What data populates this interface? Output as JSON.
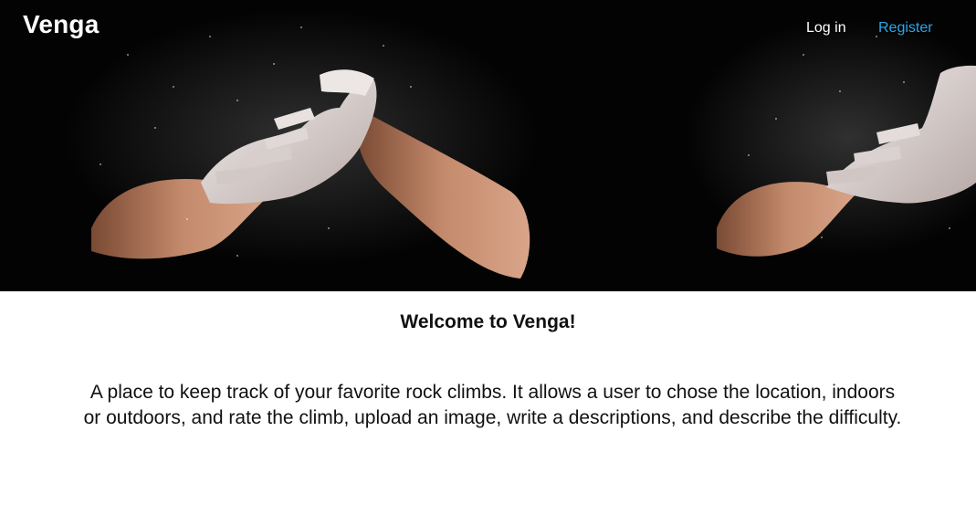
{
  "navbar": {
    "brand": "Venga",
    "login_label": "Log in",
    "register_label": "Register"
  },
  "hero": {
    "image_subject": "chalked-climbing-hands",
    "background_color": "#030303"
  },
  "main": {
    "welcome_title": "Welcome to Venga!",
    "description": "A place to keep track of your favorite rock climbs. It allows a user to chose the location, indoors or outdoors, and rate the climb, upload an image, write a descriptions, and describe the difficulty."
  },
  "colors": {
    "register_link": "#2aa8e8",
    "nav_text": "#ffffff"
  }
}
